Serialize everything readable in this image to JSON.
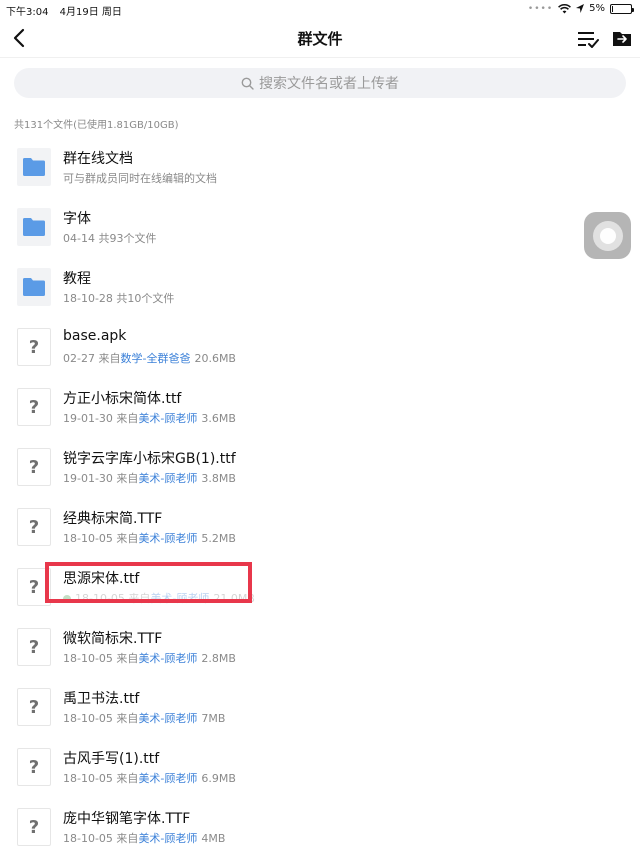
{
  "status_bar": {
    "time": "下午3:04",
    "date": "4月19日 周日",
    "battery": "5%",
    "battery_level": 0.05
  },
  "nav": {
    "title": "群文件",
    "back_icon": "chevron-left-icon",
    "sort_icon": "sort-list-icon",
    "folder_icon": "folder-transfer-icon"
  },
  "search": {
    "placeholder": "搜索文件名或者上传者"
  },
  "summary": "共131个文件(已使用1.81GB/10GB)",
  "files": [
    {
      "type": "folder",
      "name": "群在线文档",
      "meta_prefix": "可与群成员同时在线编辑的文档",
      "uploader": "",
      "size": ""
    },
    {
      "type": "folder",
      "name": "字体",
      "meta_prefix": "04-14 共93个文件",
      "uploader": "",
      "size": ""
    },
    {
      "type": "folder",
      "name": "教程",
      "meta_prefix": "18-10-28 共10个文件",
      "uploader": "",
      "size": ""
    },
    {
      "type": "file",
      "name": "base.apk",
      "meta_prefix": "02-27 来自",
      "uploader": "数学-全群爸爸",
      "size": "20.6MB"
    },
    {
      "type": "file",
      "name": "方正小标宋简体.ttf",
      "meta_prefix": "19-01-30 来自",
      "uploader": "美术-顾老师",
      "size": "3.6MB"
    },
    {
      "type": "file",
      "name": "锐字云字库小标宋GB(1).ttf",
      "meta_prefix": "19-01-30 来自",
      "uploader": "美术-顾老师",
      "size": "3.8MB"
    },
    {
      "type": "file",
      "name": "经典标宋简.TTF",
      "meta_prefix": "18-10-05 来自",
      "uploader": "美术-顾老师",
      "size": "5.2MB"
    },
    {
      "type": "file",
      "name": "思源宋体.ttf",
      "meta_prefix": "18-10-05 来自",
      "uploader": "美术-顾老师",
      "size": "21.0MB"
    },
    {
      "type": "file",
      "name": "微软简标宋.TTF",
      "meta_prefix": "18-10-05 来自",
      "uploader": "美术-顾老师",
      "size": "2.8MB"
    },
    {
      "type": "file",
      "name": "禹卫书法.ttf",
      "meta_prefix": "18-10-05 来自",
      "uploader": "美术-顾老师",
      "size": "7MB"
    },
    {
      "type": "file",
      "name": "古风手写(1).ttf",
      "meta_prefix": "18-10-05 来自",
      "uploader": "美术-顾老师",
      "size": "6.9MB"
    },
    {
      "type": "file",
      "name": "庞中华钢笔字体.TTF",
      "meta_prefix": "18-10-05 来自",
      "uploader": "美术-顾老师",
      "size": "4MB"
    }
  ],
  "colors": {
    "accent": "#3b80d8",
    "folder": "#5b9be6",
    "highlight": "#e8374b"
  }
}
